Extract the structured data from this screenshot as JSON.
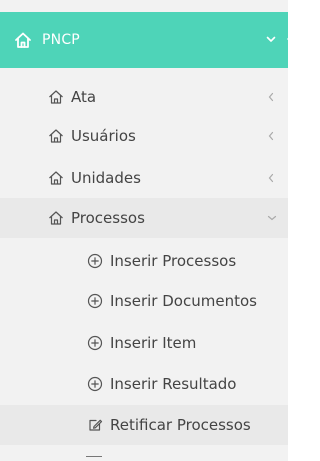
{
  "header": {
    "title": "PNCP",
    "icon": "home-icon",
    "expand_icon": "chevron-down-icon"
  },
  "menu": {
    "items": [
      {
        "label": "Ata",
        "icon": "home-outline-icon",
        "indicator": "chevron-left-icon"
      },
      {
        "label": "Usuários",
        "icon": "home-outline-icon",
        "indicator": "chevron-left-icon"
      },
      {
        "label": "Unidades",
        "icon": "home-outline-icon",
        "indicator": "chevron-left-icon"
      },
      {
        "label": "Processos",
        "icon": "home-outline-icon",
        "indicator": "chevron-down-icon",
        "expanded": true
      }
    ],
    "submenu": [
      {
        "label": "Inserir Processos",
        "icon": "plus-circle-icon"
      },
      {
        "label": "Inserir Documentos",
        "icon": "plus-circle-icon"
      },
      {
        "label": "Inserir Item",
        "icon": "plus-circle-icon"
      },
      {
        "label": "Inserir Resultado",
        "icon": "plus-circle-icon"
      },
      {
        "label": "Retificar Processos",
        "icon": "edit-icon",
        "active": true
      }
    ]
  },
  "colors": {
    "header_bg": "#4ed4b8",
    "sidebar_bg": "#f2f2f2",
    "active_bg": "#e9e9e9",
    "text": "#444444"
  }
}
